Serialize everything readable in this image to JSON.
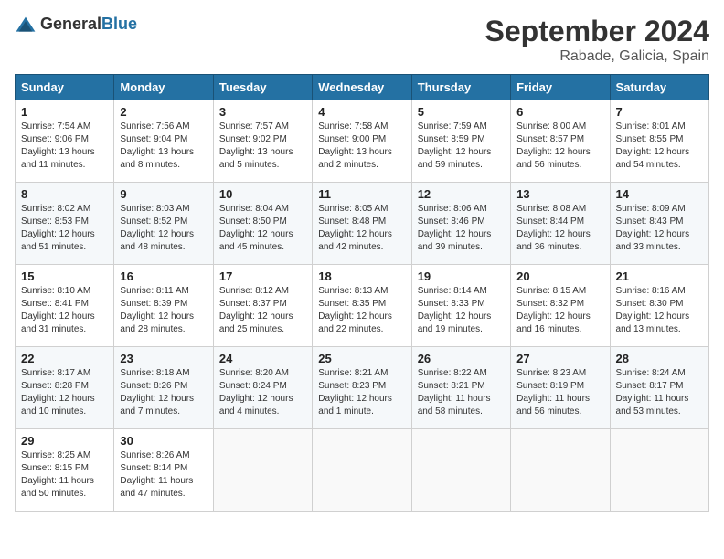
{
  "header": {
    "logo_general": "General",
    "logo_blue": "Blue",
    "month_title": "September 2024",
    "location": "Rabade, Galicia, Spain"
  },
  "weekdays": [
    "Sunday",
    "Monday",
    "Tuesday",
    "Wednesday",
    "Thursday",
    "Friday",
    "Saturday"
  ],
  "weeks": [
    [
      {
        "day": "1",
        "sunrise": "7:54 AM",
        "sunset": "9:06 PM",
        "daylight": "13 hours and 11 minutes."
      },
      {
        "day": "2",
        "sunrise": "7:56 AM",
        "sunset": "9:04 PM",
        "daylight": "13 hours and 8 minutes."
      },
      {
        "day": "3",
        "sunrise": "7:57 AM",
        "sunset": "9:02 PM",
        "daylight": "13 hours and 5 minutes."
      },
      {
        "day": "4",
        "sunrise": "7:58 AM",
        "sunset": "9:00 PM",
        "daylight": "13 hours and 2 minutes."
      },
      {
        "day": "5",
        "sunrise": "7:59 AM",
        "sunset": "8:59 PM",
        "daylight": "12 hours and 59 minutes."
      },
      {
        "day": "6",
        "sunrise": "8:00 AM",
        "sunset": "8:57 PM",
        "daylight": "12 hours and 56 minutes."
      },
      {
        "day": "7",
        "sunrise": "8:01 AM",
        "sunset": "8:55 PM",
        "daylight": "12 hours and 54 minutes."
      }
    ],
    [
      {
        "day": "8",
        "sunrise": "8:02 AM",
        "sunset": "8:53 PM",
        "daylight": "12 hours and 51 minutes."
      },
      {
        "day": "9",
        "sunrise": "8:03 AM",
        "sunset": "8:52 PM",
        "daylight": "12 hours and 48 minutes."
      },
      {
        "day": "10",
        "sunrise": "8:04 AM",
        "sunset": "8:50 PM",
        "daylight": "12 hours and 45 minutes."
      },
      {
        "day": "11",
        "sunrise": "8:05 AM",
        "sunset": "8:48 PM",
        "daylight": "12 hours and 42 minutes."
      },
      {
        "day": "12",
        "sunrise": "8:06 AM",
        "sunset": "8:46 PM",
        "daylight": "12 hours and 39 minutes."
      },
      {
        "day": "13",
        "sunrise": "8:08 AM",
        "sunset": "8:44 PM",
        "daylight": "12 hours and 36 minutes."
      },
      {
        "day": "14",
        "sunrise": "8:09 AM",
        "sunset": "8:43 PM",
        "daylight": "12 hours and 33 minutes."
      }
    ],
    [
      {
        "day": "15",
        "sunrise": "8:10 AM",
        "sunset": "8:41 PM",
        "daylight": "12 hours and 31 minutes."
      },
      {
        "day": "16",
        "sunrise": "8:11 AM",
        "sunset": "8:39 PM",
        "daylight": "12 hours and 28 minutes."
      },
      {
        "day": "17",
        "sunrise": "8:12 AM",
        "sunset": "8:37 PM",
        "daylight": "12 hours and 25 minutes."
      },
      {
        "day": "18",
        "sunrise": "8:13 AM",
        "sunset": "8:35 PM",
        "daylight": "12 hours and 22 minutes."
      },
      {
        "day": "19",
        "sunrise": "8:14 AM",
        "sunset": "8:33 PM",
        "daylight": "12 hours and 19 minutes."
      },
      {
        "day": "20",
        "sunrise": "8:15 AM",
        "sunset": "8:32 PM",
        "daylight": "12 hours and 16 minutes."
      },
      {
        "day": "21",
        "sunrise": "8:16 AM",
        "sunset": "8:30 PM",
        "daylight": "12 hours and 13 minutes."
      }
    ],
    [
      {
        "day": "22",
        "sunrise": "8:17 AM",
        "sunset": "8:28 PM",
        "daylight": "12 hours and 10 minutes."
      },
      {
        "day": "23",
        "sunrise": "8:18 AM",
        "sunset": "8:26 PM",
        "daylight": "12 hours and 7 minutes."
      },
      {
        "day": "24",
        "sunrise": "8:20 AM",
        "sunset": "8:24 PM",
        "daylight": "12 hours and 4 minutes."
      },
      {
        "day": "25",
        "sunrise": "8:21 AM",
        "sunset": "8:23 PM",
        "daylight": "12 hours and 1 minute."
      },
      {
        "day": "26",
        "sunrise": "8:22 AM",
        "sunset": "8:21 PM",
        "daylight": "11 hours and 58 minutes."
      },
      {
        "day": "27",
        "sunrise": "8:23 AM",
        "sunset": "8:19 PM",
        "daylight": "11 hours and 56 minutes."
      },
      {
        "day": "28",
        "sunrise": "8:24 AM",
        "sunset": "8:17 PM",
        "daylight": "11 hours and 53 minutes."
      }
    ],
    [
      {
        "day": "29",
        "sunrise": "8:25 AM",
        "sunset": "8:15 PM",
        "daylight": "11 hours and 50 minutes."
      },
      {
        "day": "30",
        "sunrise": "8:26 AM",
        "sunset": "8:14 PM",
        "daylight": "11 hours and 47 minutes."
      },
      null,
      null,
      null,
      null,
      null
    ]
  ]
}
